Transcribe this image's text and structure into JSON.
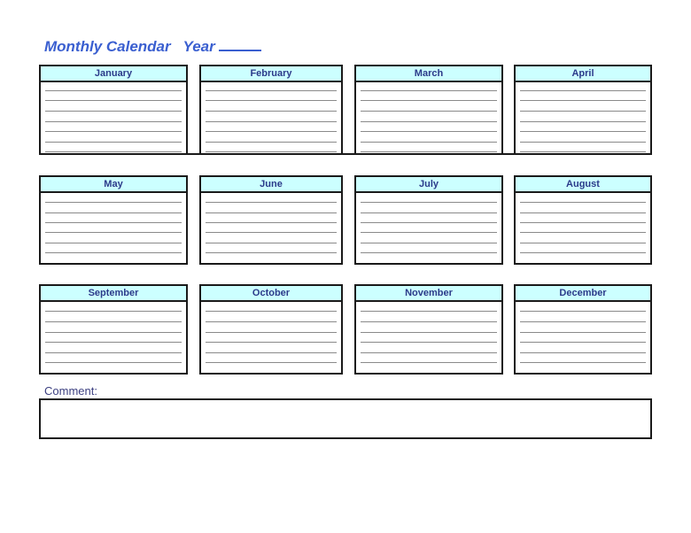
{
  "header": {
    "title": "Monthly Calendar",
    "year_label": "Year",
    "year_value": ""
  },
  "months": [
    {
      "name": "January"
    },
    {
      "name": "February"
    },
    {
      "name": "March"
    },
    {
      "name": "April"
    },
    {
      "name": "May"
    },
    {
      "name": "June"
    },
    {
      "name": "July"
    },
    {
      "name": "August"
    },
    {
      "name": "September"
    },
    {
      "name": "October"
    },
    {
      "name": "November"
    },
    {
      "name": "December"
    }
  ],
  "comment": {
    "label": "Comment:",
    "value": ""
  },
  "colors": {
    "title": "#3a5fd0",
    "header_fill": "#ccffff",
    "header_text": "#2b3a8a",
    "border": "#1a1a1a",
    "ruled_line": "#8a8a8a"
  }
}
